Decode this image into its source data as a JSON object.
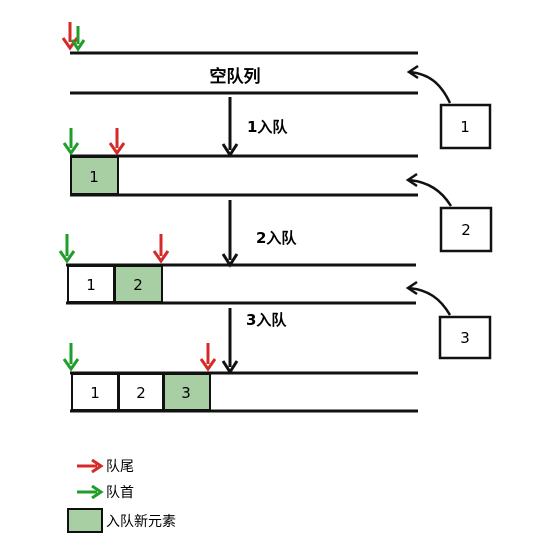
{
  "title": "空队列",
  "colors": {
    "tail": "#d42a2a",
    "head": "#1f9e2a",
    "new_fill": "#a8cfa4",
    "line": "#111111"
  },
  "steps": [
    {
      "label": "1入队",
      "input": "1",
      "cells": [
        "1"
      ]
    },
    {
      "label": "2入队",
      "input": "2",
      "cells": [
        "1",
        "2"
      ]
    },
    {
      "label": "3入队",
      "input": "3",
      "cells": [
        "1",
        "2",
        "3"
      ]
    }
  ],
  "legend": {
    "tail": "队尾",
    "head": "队首",
    "new_element": "入队新元素"
  }
}
